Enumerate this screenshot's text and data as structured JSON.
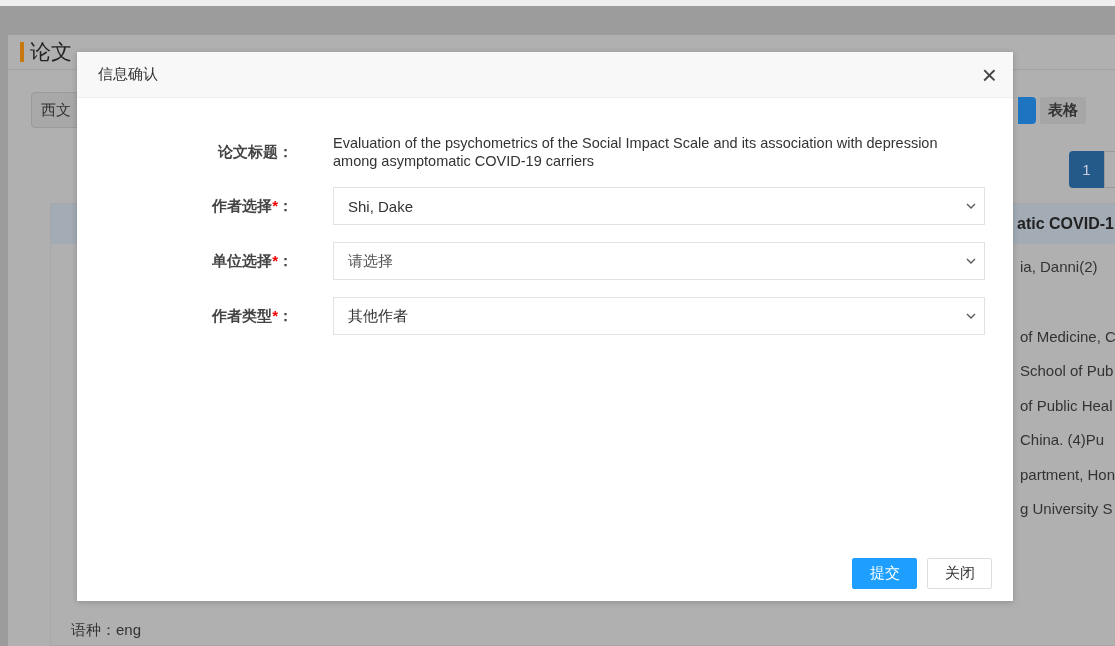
{
  "page": {
    "heading": "论文",
    "source_tab": "西文",
    "view_buttons": [
      {
        "label": "表格",
        "selected": false
      }
    ],
    "pagination": [
      {
        "label": "1",
        "selected": true
      }
    ],
    "record": {
      "title": "atic COVID-1",
      "lines": [
        "ia, Danni(2)",
        "of Medicine, C",
        "School of Pub",
        "of Public Heal",
        "China.   (4)Pu",
        "partment, Hon",
        "g University S"
      ],
      "language": "语种：eng"
    }
  },
  "dialog": {
    "title": "信息确认",
    "fields": [
      {
        "kind": "text",
        "label": "论文标题",
        "required": false,
        "colon": "：",
        "value": "Evaluation of the psychometrics of the Social Impact Scale and its association with depression among asymptomatic COVID-19 carriers"
      },
      {
        "kind": "select",
        "label": "作者选择",
        "required": true,
        "colon": "：",
        "value": "Shi, Dake"
      },
      {
        "kind": "select",
        "label": "单位选择",
        "required": true,
        "colon": "：",
        "placeholder": "请选择"
      },
      {
        "kind": "select",
        "label": "作者类型",
        "required": true,
        "colon": "：",
        "value": "其他作者"
      }
    ],
    "required_mark": "*",
    "close": "×",
    "buttons": [
      {
        "kind": "primary",
        "label": "提交"
      },
      {
        "kind": "default",
        "label": "关闭"
      }
    ]
  }
}
